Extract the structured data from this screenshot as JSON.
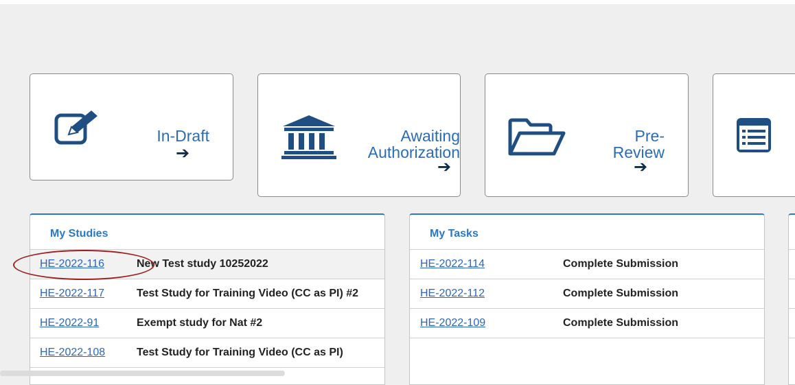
{
  "cards": [
    {
      "label": "In-Draft",
      "icon": "edit-square-icon"
    },
    {
      "label": "Awaiting\nAuthorization",
      "icon": "bank-icon"
    },
    {
      "label": "Pre-\nReview",
      "icon": "folder-open-icon"
    },
    {
      "label": "",
      "icon": "list-icon"
    }
  ],
  "arrow_glyph": "➔",
  "my_studies": {
    "title": "My Studies",
    "rows": [
      {
        "id": "HE-2022-116",
        "title": "New Test study 10252022"
      },
      {
        "id": "HE-2022-117",
        "title": "Test Study for Training Video (CC as PI) #2"
      },
      {
        "id": "HE-2022-91",
        "title": "Exempt study for Nat #2"
      },
      {
        "id": "HE-2022-108",
        "title": "Test Study for Training Video (CC as PI)"
      }
    ]
  },
  "my_tasks": {
    "title": "My Tasks",
    "rows": [
      {
        "id": "HE-2022-114",
        "title": "Complete Submission"
      },
      {
        "id": "HE-2022-112",
        "title": "Complete Submission"
      },
      {
        "id": "HE-2022-109",
        "title": "Complete Submission"
      }
    ]
  },
  "colors": {
    "accent": "#2a78c5",
    "icon": "#1f4e82",
    "annotation": "#a02020"
  }
}
